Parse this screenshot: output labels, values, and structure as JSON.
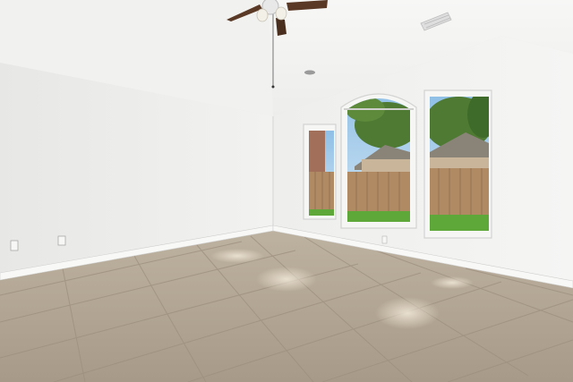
{
  "scene": {
    "kind": "empty interior room photograph",
    "features": [
      "ceiling-fan",
      "air-vent",
      "return-vent",
      "arched-window",
      "window-left",
      "window-right",
      "tile-floor",
      "baseboard",
      "wall-outlet"
    ],
    "colors": {
      "wall_left": "#eeeeec",
      "wall_right": "#f1f1ef",
      "ceiling": "#f4f4f3",
      "floor": "#b3a593",
      "grout": "#9c8f7e",
      "sky": "#a9cdeb",
      "fence": "#b08a62",
      "grass": "#5ea83a",
      "foliage": "#4f7a33",
      "fan_blade": "#5a3a26"
    }
  }
}
